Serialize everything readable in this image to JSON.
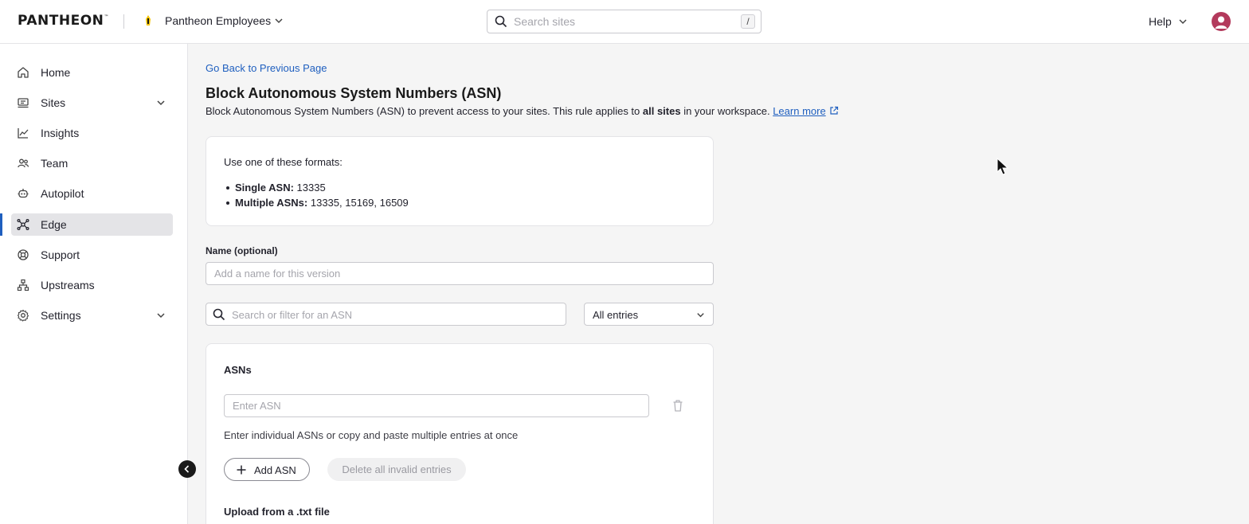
{
  "topbar": {
    "logo": "PANTHEON",
    "logo_mark": "™",
    "workspace_name": "Pantheon Employees",
    "search_placeholder": "Search sites",
    "search_shortcut": "/",
    "help_label": "Help"
  },
  "sidebar": {
    "items": [
      {
        "label": "Home",
        "icon": "home-icon"
      },
      {
        "label": "Sites",
        "icon": "sites-icon",
        "expandable": true
      },
      {
        "label": "Insights",
        "icon": "insights-icon"
      },
      {
        "label": "Team",
        "icon": "team-icon"
      },
      {
        "label": "Autopilot",
        "icon": "autopilot-icon"
      },
      {
        "label": "Edge",
        "icon": "edge-icon",
        "active": true
      },
      {
        "label": "Support",
        "icon": "support-icon"
      },
      {
        "label": "Upstreams",
        "icon": "upstreams-icon"
      },
      {
        "label": "Settings",
        "icon": "gear-icon",
        "expandable": true
      }
    ]
  },
  "main": {
    "back_link": "Go Back to Previous Page",
    "title": "Block Autonomous System Numbers (ASN)",
    "description_pre": "Block Autonomous System Numbers (ASN) to prevent access to your sites. This rule applies to ",
    "description_bold": "all sites",
    "description_post": " in your workspace. ",
    "learn_more": "Learn more",
    "formats": {
      "intro": "Use one of these formats:",
      "items": [
        {
          "label": "Single ASN:",
          "value": " 13335"
        },
        {
          "label": "Multiple ASNs:",
          "value": " 13335, 15169, 16509"
        }
      ]
    },
    "name_label": "Name (optional)",
    "name_placeholder": "Add a name for this version",
    "filter_placeholder": "Search or filter for an ASN",
    "filter_select": "All entries",
    "asn_section": {
      "title": "ASNs",
      "input_placeholder": "Enter ASN",
      "help_text": "Enter individual ASNs or copy and paste multiple entries at once",
      "add_button": "Add ASN",
      "delete_invalid_button": "Delete all invalid entries",
      "upload_title": "Upload from a .txt file"
    }
  },
  "colors": {
    "accent": "#1f5fbf",
    "avatar": "#b33a5c",
    "active_nav_bg": "#e4e4e7"
  }
}
